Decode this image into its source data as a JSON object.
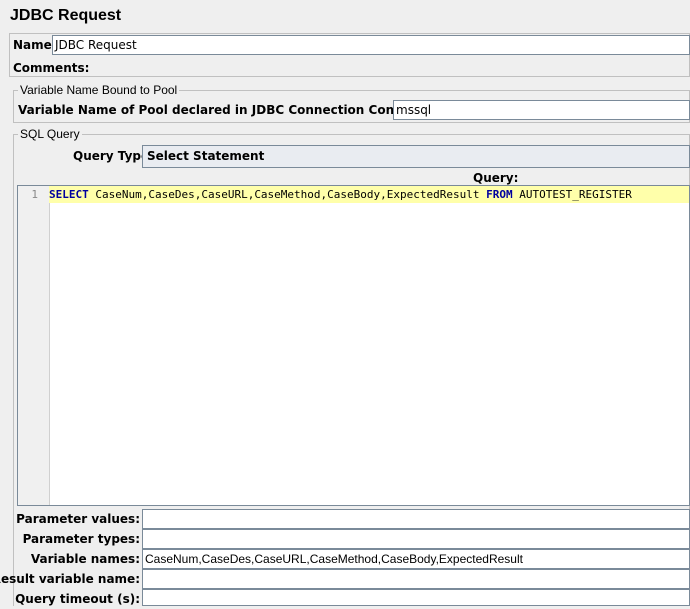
{
  "window": {
    "title": "JDBC Request"
  },
  "name_field": {
    "label": "Name:",
    "value": "JDBC Request"
  },
  "comments": {
    "label": "Comments:"
  },
  "pool_group": {
    "title": "Variable Name Bound to Pool",
    "label": "Variable Name of Pool declared in JDBC Connection Configuration:",
    "value": "mssql"
  },
  "sql_group": {
    "title": "SQL Query",
    "query_type_label": "Query Type:",
    "query_type_value": "Select Statement",
    "query_label": "Query:",
    "editor": {
      "line_number": "1",
      "kw_select": "SELECT",
      "columns": " CaseNum,CaseDes,CaseURL,CaseMethod,CaseBody,ExpectedResult ",
      "kw_from": "FROM",
      "table": " AUTOTEST_REGISTER"
    }
  },
  "params": {
    "parameter_values": {
      "label": "Parameter values:",
      "value": ""
    },
    "parameter_types": {
      "label": "Parameter types:",
      "value": ""
    },
    "variable_names": {
      "label": "Variable names:",
      "value": "CaseNum,CaseDes,CaseURL,CaseMethod,CaseBody,ExpectedResult"
    },
    "result_variable_name": {
      "label": "Result variable name:",
      "value": ""
    },
    "query_timeout": {
      "label": "Query timeout (s):",
      "value": ""
    }
  }
}
